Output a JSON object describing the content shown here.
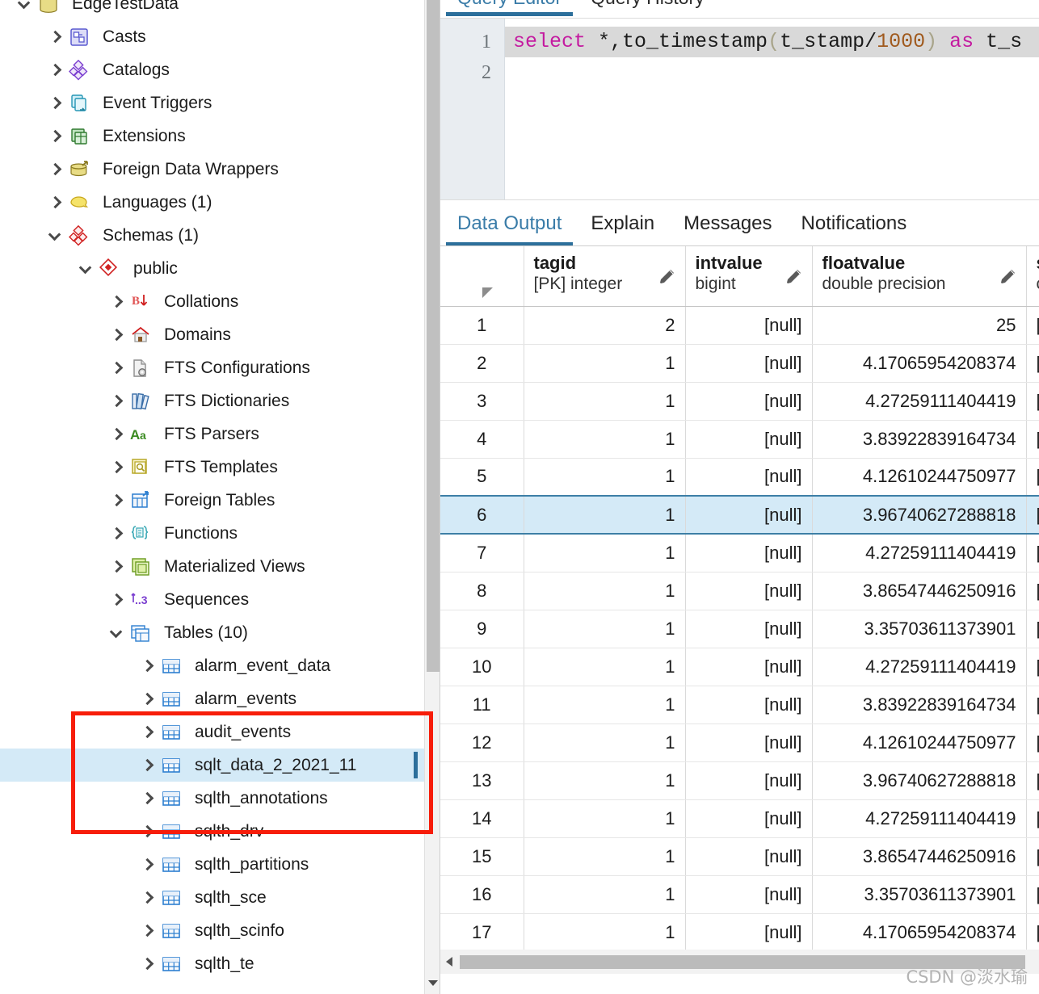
{
  "sidebar": {
    "scrollbar": {
      "name": "vertical-scrollbar"
    },
    "tree": [
      {
        "label": "EdgeTestData",
        "level": 0,
        "state": "expanded",
        "icon": "database-icon",
        "selected": false
      },
      {
        "label": "Casts",
        "level": 1,
        "state": "collapsed",
        "icon": "casts-icon",
        "selected": false
      },
      {
        "label": "Catalogs",
        "level": 1,
        "state": "collapsed",
        "icon": "catalogs-icon",
        "selected": false
      },
      {
        "label": "Event Triggers",
        "level": 1,
        "state": "collapsed",
        "icon": "event-triggers-icon",
        "selected": false
      },
      {
        "label": "Extensions",
        "level": 1,
        "state": "collapsed",
        "icon": "extensions-icon",
        "selected": false
      },
      {
        "label": "Foreign Data Wrappers",
        "level": 1,
        "state": "collapsed",
        "icon": "foreign-data-wrappers-icon",
        "selected": false
      },
      {
        "label": "Languages (1)",
        "level": 1,
        "state": "collapsed",
        "icon": "languages-icon",
        "selected": false
      },
      {
        "label": "Schemas (1)",
        "level": 1,
        "state": "expanded",
        "icon": "schemas-icon",
        "selected": false
      },
      {
        "label": "public",
        "level": 2,
        "state": "expanded",
        "icon": "schema-icon",
        "selected": false
      },
      {
        "label": "Collations",
        "level": 3,
        "state": "collapsed",
        "icon": "collations-icon",
        "selected": false
      },
      {
        "label": "Domains",
        "level": 3,
        "state": "collapsed",
        "icon": "domains-icon",
        "selected": false
      },
      {
        "label": "FTS Configurations",
        "level": 3,
        "state": "collapsed",
        "icon": "fts-configurations-icon",
        "selected": false
      },
      {
        "label": "FTS Dictionaries",
        "level": 3,
        "state": "collapsed",
        "icon": "fts-dictionaries-icon",
        "selected": false
      },
      {
        "label": "FTS Parsers",
        "level": 3,
        "state": "collapsed",
        "icon": "fts-parsers-icon",
        "selected": false
      },
      {
        "label": "FTS Templates",
        "level": 3,
        "state": "collapsed",
        "icon": "fts-templates-icon",
        "selected": false
      },
      {
        "label": "Foreign Tables",
        "level": 3,
        "state": "collapsed",
        "icon": "foreign-tables-icon",
        "selected": false
      },
      {
        "label": "Functions",
        "level": 3,
        "state": "collapsed",
        "icon": "functions-icon",
        "selected": false
      },
      {
        "label": "Materialized Views",
        "level": 3,
        "state": "collapsed",
        "icon": "materialized-views-icon",
        "selected": false
      },
      {
        "label": "Sequences",
        "level": 3,
        "state": "collapsed",
        "icon": "sequences-icon",
        "selected": false
      },
      {
        "label": "Tables (10)",
        "level": 3,
        "state": "expanded",
        "icon": "tables-icon",
        "selected": false
      },
      {
        "label": "alarm_event_data",
        "level": 4,
        "state": "collapsed",
        "icon": "table-icon",
        "selected": false
      },
      {
        "label": "alarm_events",
        "level": 4,
        "state": "collapsed",
        "icon": "table-icon",
        "selected": false
      },
      {
        "label": "audit_events",
        "level": 4,
        "state": "collapsed",
        "icon": "table-icon",
        "selected": false
      },
      {
        "label": "sqlt_data_2_2021_11",
        "level": 4,
        "state": "collapsed",
        "icon": "table-icon",
        "selected": true
      },
      {
        "label": "sqlth_annotations",
        "level": 4,
        "state": "collapsed",
        "icon": "table-icon",
        "selected": false
      },
      {
        "label": "sqlth_drv",
        "level": 4,
        "state": "collapsed",
        "icon": "table-icon",
        "selected": false
      },
      {
        "label": "sqlth_partitions",
        "level": 4,
        "state": "collapsed",
        "icon": "table-icon",
        "selected": false
      },
      {
        "label": "sqlth_sce",
        "level": 4,
        "state": "collapsed",
        "icon": "table-icon",
        "selected": false
      },
      {
        "label": "sqlth_scinfo",
        "level": 4,
        "state": "collapsed",
        "icon": "table-icon",
        "selected": false
      },
      {
        "label": "sqlth_te",
        "level": 4,
        "state": "collapsed",
        "icon": "table-icon",
        "selected": false
      }
    ]
  },
  "annotation": {
    "shape": "rectangle",
    "color": "#f71d0a"
  },
  "query_tabs": [
    {
      "label": "Query Editor",
      "active": true
    },
    {
      "label": "Query History",
      "active": false
    }
  ],
  "editor": {
    "line_numbers": [
      "1",
      "2"
    ],
    "sql_tokens": [
      {
        "text": "select",
        "kind": "keyword"
      },
      {
        "text": " *,",
        "kind": "plain"
      },
      {
        "text": "to_timestamp",
        "kind": "function"
      },
      {
        "text": "(",
        "kind": "paren"
      },
      {
        "text": "t_stamp/",
        "kind": "plain"
      },
      {
        "text": "1000",
        "kind": "number"
      },
      {
        "text": ")",
        "kind": "paren"
      },
      {
        "text": " ",
        "kind": "plain"
      },
      {
        "text": "as",
        "kind": "keyword"
      },
      {
        "text": " t_s",
        "kind": "plain"
      }
    ],
    "sql_text": "select *,to_timestamp(t_stamp/1000) as t_s"
  },
  "output_tabs": [
    {
      "label": "Data Output",
      "active": true
    },
    {
      "label": "Explain",
      "active": false
    },
    {
      "label": "Messages",
      "active": false
    },
    {
      "label": "Notifications",
      "active": false
    }
  ],
  "grid": {
    "columns": [
      {
        "name": "",
        "type": "",
        "rowheader": true
      },
      {
        "name": "tagid",
        "type": "[PK] integer"
      },
      {
        "name": "intvalue",
        "type": "bigint"
      },
      {
        "name": "floatvalue",
        "type": "double precision"
      },
      {
        "name": "s",
        "type": "c"
      }
    ],
    "rows": [
      {
        "idx": "1",
        "tagid": "2",
        "intvalue": "[null]",
        "floatvalue": "25",
        "s": "[n",
        "selected": false
      },
      {
        "idx": "2",
        "tagid": "1",
        "intvalue": "[null]",
        "floatvalue": "4.17065954208374",
        "s": "[n",
        "selected": false
      },
      {
        "idx": "3",
        "tagid": "1",
        "intvalue": "[null]",
        "floatvalue": "4.27259111404419",
        "s": "[n",
        "selected": false
      },
      {
        "idx": "4",
        "tagid": "1",
        "intvalue": "[null]",
        "floatvalue": "3.83922839164734",
        "s": "[n",
        "selected": false
      },
      {
        "idx": "5",
        "tagid": "1",
        "intvalue": "[null]",
        "floatvalue": "4.12610244750977",
        "s": "[n",
        "selected": false
      },
      {
        "idx": "6",
        "tagid": "1",
        "intvalue": "[null]",
        "floatvalue": "3.96740627288818",
        "s": "[n",
        "selected": true
      },
      {
        "idx": "7",
        "tagid": "1",
        "intvalue": "[null]",
        "floatvalue": "4.27259111404419",
        "s": "[n",
        "selected": false
      },
      {
        "idx": "8",
        "tagid": "1",
        "intvalue": "[null]",
        "floatvalue": "3.86547446250916",
        "s": "[n",
        "selected": false
      },
      {
        "idx": "9",
        "tagid": "1",
        "intvalue": "[null]",
        "floatvalue": "3.35703611373901",
        "s": "[n",
        "selected": false
      },
      {
        "idx": "10",
        "tagid": "1",
        "intvalue": "[null]",
        "floatvalue": "4.27259111404419",
        "s": "[n",
        "selected": false
      },
      {
        "idx": "11",
        "tagid": "1",
        "intvalue": "[null]",
        "floatvalue": "3.83922839164734",
        "s": "[n",
        "selected": false
      },
      {
        "idx": "12",
        "tagid": "1",
        "intvalue": "[null]",
        "floatvalue": "4.12610244750977",
        "s": "[n",
        "selected": false
      },
      {
        "idx": "13",
        "tagid": "1",
        "intvalue": "[null]",
        "floatvalue": "3.96740627288818",
        "s": "[n",
        "selected": false
      },
      {
        "idx": "14",
        "tagid": "1",
        "intvalue": "[null]",
        "floatvalue": "4.27259111404419",
        "s": "[n",
        "selected": false
      },
      {
        "idx": "15",
        "tagid": "1",
        "intvalue": "[null]",
        "floatvalue": "3.86547446250916",
        "s": "[n",
        "selected": false
      },
      {
        "idx": "16",
        "tagid": "1",
        "intvalue": "[null]",
        "floatvalue": "3.35703611373901",
        "s": "[n",
        "selected": false
      },
      {
        "idx": "17",
        "tagid": "1",
        "intvalue": "[null]",
        "floatvalue": "4.17065954208374",
        "s": "[n",
        "selected": false
      }
    ]
  },
  "watermark": "CSDN @淡水瑜",
  "colors": {
    "accent": "#2c6f9b",
    "selection": "#d4eaf7",
    "annotation": "#f71d0a",
    "keyword": "#c41ba0",
    "number": "#a05a1e"
  }
}
